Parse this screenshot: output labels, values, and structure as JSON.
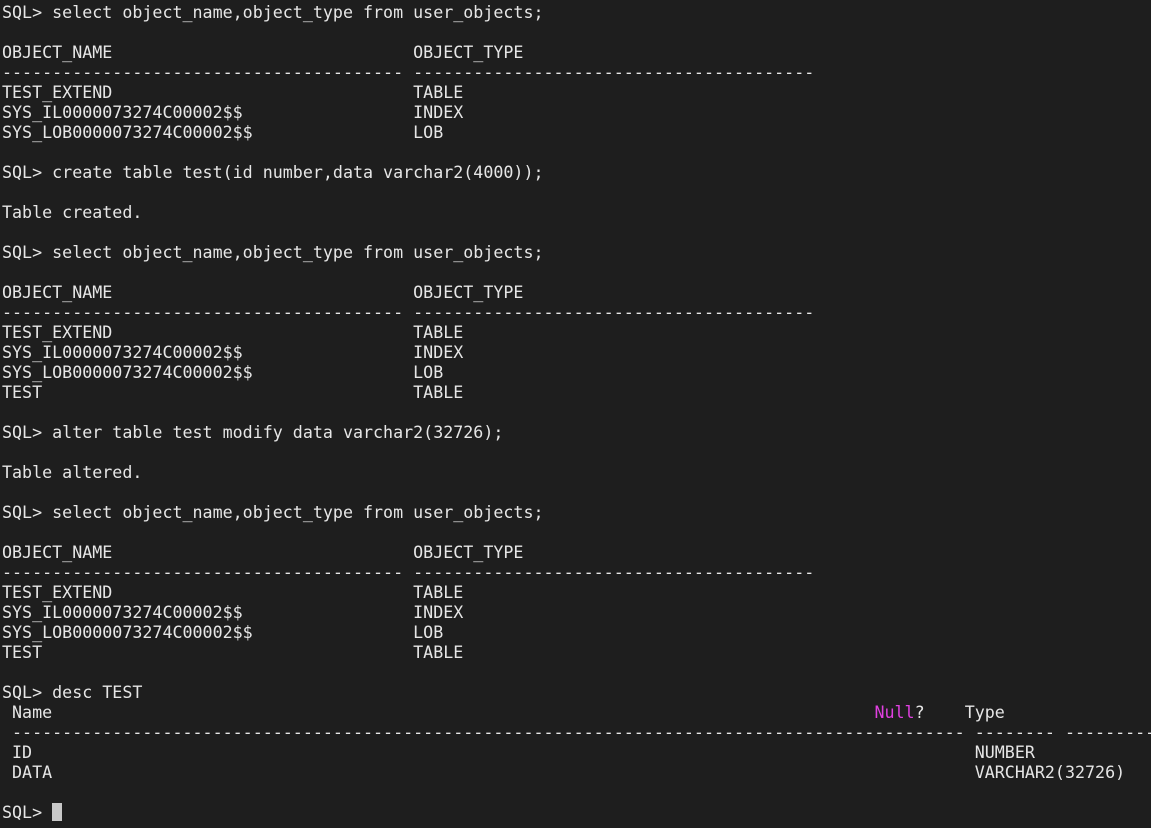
{
  "terminal": {
    "lines": [
      "SQL> select object_name,object_type from user_objects;",
      "",
      "OBJECT_NAME                              OBJECT_TYPE",
      "---------------------------------------- ----------------------------------------",
      "TEST_EXTEND                              TABLE",
      "SYS_IL0000073274C00002$$                 INDEX",
      "SYS_LOB0000073274C00002$$                LOB",
      "",
      "SQL> create table test(id number,data varchar2(4000));",
      "",
      "Table created.",
      "",
      "SQL> select object_name,object_type from user_objects;",
      "",
      "OBJECT_NAME                              OBJECT_TYPE",
      "---------------------------------------- ----------------------------------------",
      "TEST_EXTEND                              TABLE",
      "SYS_IL0000073274C00002$$                 INDEX",
      "SYS_LOB0000073274C00002$$                LOB",
      "TEST                                     TABLE",
      "",
      "SQL> alter table test modify data varchar2(32726);",
      "",
      "Table altered.",
      "",
      "SQL> select object_name,object_type from user_objects;",
      "",
      "OBJECT_NAME                              OBJECT_TYPE",
      "---------------------------------------- ----------------------------------------",
      "TEST_EXTEND                              TABLE",
      "SYS_IL0000073274C00002$$                 INDEX",
      "SYS_LOB0000073274C00002$$                LOB",
      "TEST                                     TABLE",
      "",
      "SQL> desc TEST"
    ],
    "desc_header": {
      "name": " Name                                                                                  ",
      "null_word": "Null",
      "null_rest": "?    Type"
    },
    "desc_rule": " ----------------------------------------------------------------------------------------------- -------- ------------------------------------",
    "desc_rows": [
      " ID                                                                                              NUMBER",
      " DATA                                                                                            VARCHAR2(32726)"
    ],
    "prompt": "SQL> ",
    "colors": {
      "background": "#1e1e1e",
      "text": "#e6e6e6",
      "highlight": "#e040e0",
      "cursor": "#c8c8c8"
    }
  }
}
